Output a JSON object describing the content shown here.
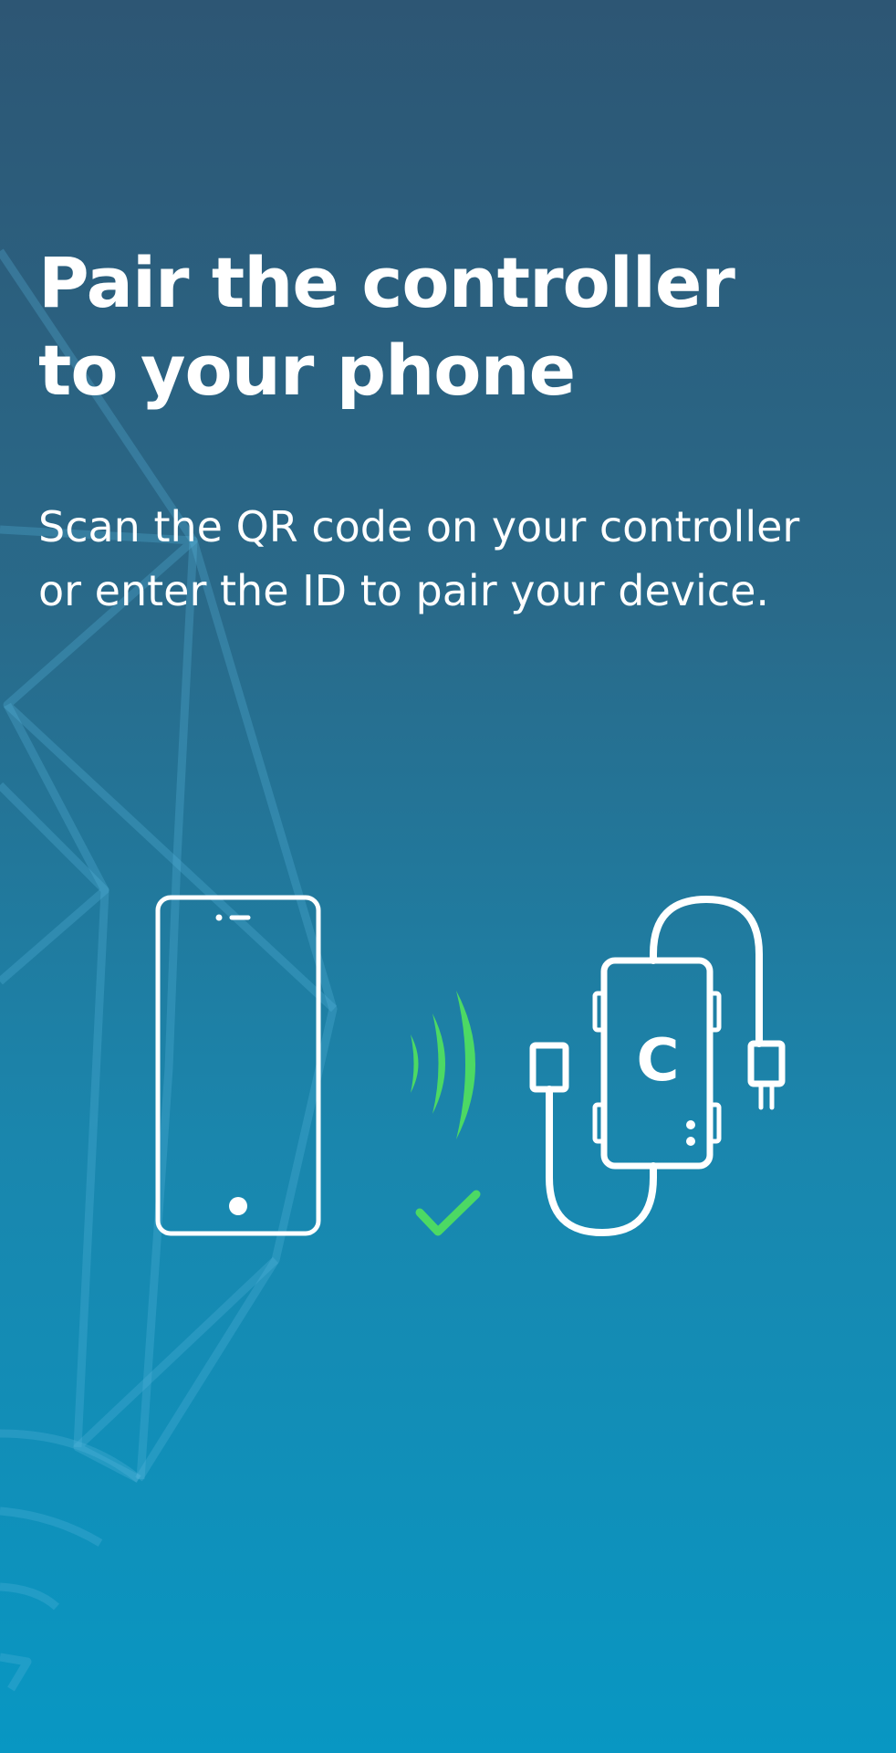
{
  "onboarding": {
    "title_line1": "Pair the controller",
    "title_line2": "to your phone",
    "subtitle_line1": "Scan the QR code on your controller",
    "subtitle_line2": "or enter the ID to pair your device.",
    "controller_letter": "C"
  },
  "icons": {
    "phone": "phone-icon",
    "signal": "wireless-signal-icon",
    "check": "check-icon",
    "controller": "controller-device-icon"
  },
  "colors": {
    "gradient_top": "#2d5674",
    "gradient_bottom": "#0897c3",
    "text": "#ffffff",
    "success": "#4cd964"
  }
}
